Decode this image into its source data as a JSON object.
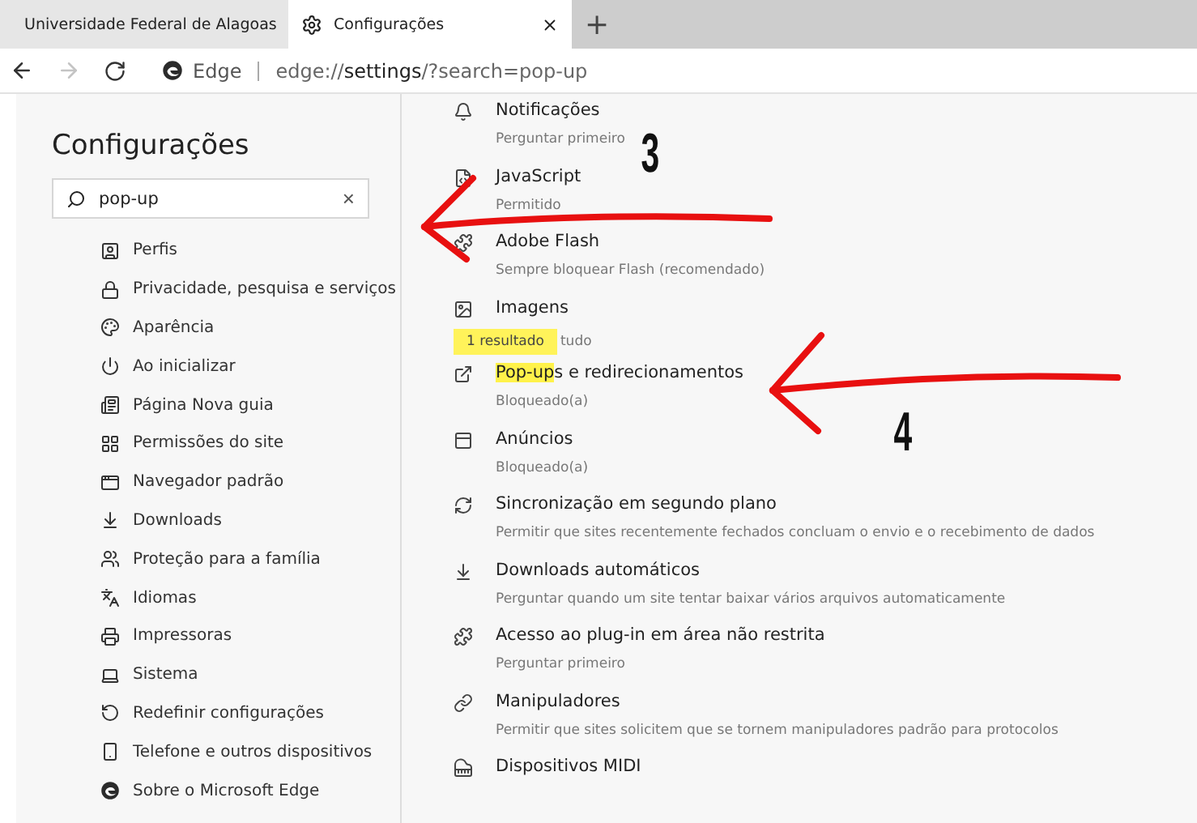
{
  "tabs": [
    {
      "label": "Universidade Federal de Alagoas",
      "selected": false
    },
    {
      "label": "Configurações",
      "selected": true
    }
  ],
  "new_tab": "+",
  "address_bar": {
    "brand": "Edge",
    "url": "edge://**settings**/?search=pop-up",
    "forward_disabled": true
  },
  "sidebar": {
    "title": "Configurações",
    "search": {
      "value": "pop-up",
      "clear": "×"
    },
    "items": [
      {
        "label": "Perfis"
      },
      {
        "label": "Privacidade, pesquisa e serviços"
      },
      {
        "label": "Aparência"
      },
      {
        "label": "Ao inicializar"
      },
      {
        "label": "Página Nova guia"
      },
      {
        "label": "Permissões do site"
      },
      {
        "label": "Navegador padrão"
      },
      {
        "label": "Downloads"
      },
      {
        "label": "Proteção para a família"
      },
      {
        "label": "Idiomas"
      },
      {
        "label": "Impressoras"
      },
      {
        "label": "Sistema"
      },
      {
        "label": "Redefinir configurações"
      },
      {
        "label": "Telefone e outros dispositivos"
      },
      {
        "label": "Sobre o Microsoft Edge"
      }
    ]
  },
  "permissions": [
    {
      "title": "Notificações",
      "subtitle": "Perguntar primeiro"
    },
    {
      "title": "JavaScript",
      "subtitle": "Permitido"
    },
    {
      "title": "Adobe Flash",
      "subtitle": "Sempre bloquear Flash (recomendado)"
    },
    {
      "title": "Imagens",
      "subtitle": "tudo",
      "tooltip": "1 resultado"
    },
    {
      "highlight": "Pop-up",
      "title": "s e redirecionamentos",
      "subtitle": "Bloqueado(a)"
    },
    {
      "title": "Anúncios",
      "subtitle": "Bloqueado(a)"
    },
    {
      "title": "Sincronização em segundo plano",
      "subtitle": "Permitir que sites recentemente fechados concluam o envio e o recebimento de dados"
    },
    {
      "title": "Downloads automáticos",
      "subtitle": "Perguntar quando um site tentar baixar vários arquivos automaticamente"
    },
    {
      "title": "Acesso ao plug-in em área não restrita",
      "subtitle": "Perguntar primeiro"
    },
    {
      "title": "Manipuladores",
      "subtitle": "Permitir que sites solicitem que se tornem manipuladores padrão para protocolos"
    },
    {
      "title": "Dispositivos MIDI"
    }
  ],
  "annotations": [
    {
      "number": "3"
    },
    {
      "number": "4"
    }
  ]
}
